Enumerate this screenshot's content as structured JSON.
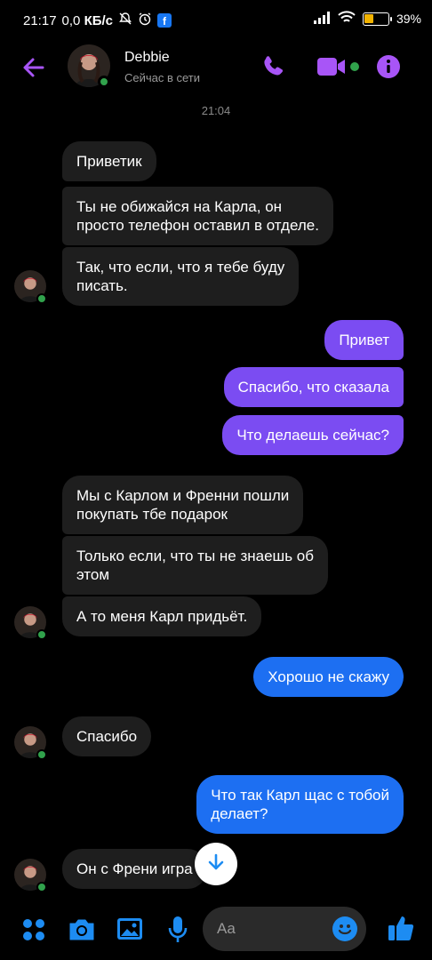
{
  "status_bar": {
    "time": "21:17",
    "network_speed": "0,0",
    "network_unit": "КБ/с",
    "battery": "39%"
  },
  "header": {
    "contact_name": "Debbie",
    "contact_status": "Сейчас в сети"
  },
  "time_separator": "21:04",
  "messages": [
    {
      "from": "them",
      "text": "Приветик"
    },
    {
      "from": "them",
      "lines": [
        "Ты не обижайся на Карла, он",
        "просто телефон оставил в отделе."
      ]
    },
    {
      "from": "them",
      "lines": [
        "Так, что если, что я тебе буду",
        "писать."
      ]
    },
    {
      "from": "me",
      "text": "Привет"
    },
    {
      "from": "me",
      "text": "Спасибо, что сказала"
    },
    {
      "from": "me",
      "text": "Что делаешь сейчас?"
    },
    {
      "from": "them",
      "lines": [
        "Мы с Карлом и Френни пошли",
        "покупать тбе подарок"
      ]
    },
    {
      "from": "them",
      "lines": [
        "Только если, что ты не знаешь об",
        "этом"
      ]
    },
    {
      "from": "them",
      "text": "А то меня Карл придьёт."
    },
    {
      "from": "me",
      "text": "Хорошо не скажу"
    },
    {
      "from": "them",
      "text": "Спасибо"
    },
    {
      "from": "me",
      "lines": [
        "Что так Карл щас с тобой",
        "делает?"
      ]
    },
    {
      "from": "them",
      "text": "Он с Френи игра"
    }
  ],
  "composer": {
    "placeholder": "Aa"
  },
  "colors": {
    "accent_purple": "#a855f7",
    "outgoing_purple": "#7b4cf2",
    "outgoing_blue": "#1d6ff2",
    "incoming_bg": "#1e1e1e",
    "online_green": "#31a24c",
    "icon_blue": "#1d8cf2"
  },
  "icons": {
    "header": [
      "back-arrow-icon",
      "phone-icon",
      "video-camera-icon",
      "info-icon"
    ],
    "bottom": [
      "apps-grid-icon",
      "camera-icon",
      "image-icon",
      "microphone-icon",
      "emoji-icon",
      "thumbs-up-icon"
    ],
    "scroll": "arrow-down-icon"
  }
}
